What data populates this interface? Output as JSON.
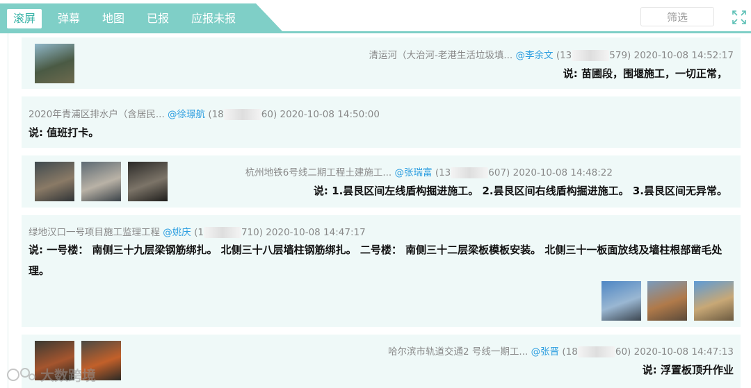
{
  "tabs": [
    "滚屏",
    "弹幕",
    "地图",
    "已报",
    "应报未报"
  ],
  "filter_label": "筛选",
  "said_prefix": "说: ",
  "posts": [
    {
      "title": "清运河（大治河-老港生活垃圾填...",
      "user": "@李余文",
      "phone_prefix": "(13",
      "phone_suffix": "579)",
      "time": "2020-10-08 14:52:17",
      "text": "苗圃段，围堰施工，一切正常，",
      "thumbs": [
        {
          "colors": [
            "#8fb7c9",
            "#4a5a44",
            "#6d6a4e"
          ]
        }
      ]
    },
    {
      "title": "2020年青浦区排水户（含居民...",
      "user": "@徐璟航",
      "phone_prefix": "(18",
      "phone_suffix": "60)",
      "time": "2020-10-08 14:50:00",
      "text": "值班打卡。",
      "thumbs": []
    },
    {
      "title": "杭州地铁6号线二期工程土建施工...",
      "user": "@张瑞富",
      "phone_prefix": "(13",
      "phone_suffix": "607)",
      "time": "2020-10-08 14:48:22",
      "text": "1.昙艮区间左线盾构掘进施工。 2.昙艮区间右线盾构掘进施工。 3.昙艮区间无异常。",
      "thumbs": [
        {
          "colors": [
            "#3f4a4f",
            "#8a7a66",
            "#2f3336"
          ]
        },
        {
          "colors": [
            "#5d6a73",
            "#b9b2a6",
            "#3a4248"
          ]
        },
        {
          "colors": [
            "#2b2a28",
            "#7c7468",
            "#1e1d1b"
          ]
        }
      ]
    },
    {
      "title": "绿地汉口一号项目施工监理工程",
      "user": "@姚庆",
      "phone_prefix": "(1",
      "phone_suffix": "710)",
      "time": "2020-10-08 14:47:17",
      "text": "一号楼： 南侧三十九层梁钢筋绑扎。 北侧三十八层墙柱钢筋绑扎。 二号楼： 南侧三十二层梁板模板安装。 北侧三十一板面放线及墙柱根部凿毛处理。",
      "thumbs": [
        {
          "colors": [
            "#4e86c4",
            "#9ab7d2",
            "#3c4650"
          ]
        },
        {
          "colors": [
            "#7a9bbd",
            "#b07a4a",
            "#5a4a3a"
          ]
        },
        {
          "colors": [
            "#5d9bd6",
            "#c8a876",
            "#6b5a40"
          ]
        }
      ]
    },
    {
      "title": "哈尔滨市轨道交通2 号线一期工...",
      "user": "@张晋",
      "phone_prefix": "(18",
      "phone_suffix": "60)",
      "time": "2020-10-08 14:47:13",
      "text": "浮置板顶升作业",
      "thumbs": [
        {
          "colors": [
            "#3b3a33",
            "#a5552e",
            "#252520"
          ]
        },
        {
          "colors": [
            "#4a4a44",
            "#c2602a",
            "#2a2a26"
          ]
        }
      ]
    }
  ],
  "watermark": "大数跨境",
  "colors": {
    "accent": "#7fcfc7",
    "tab_bg": "#7fcfc7",
    "card_bg": "#eff9f8",
    "user_link": "#2e9fe0"
  },
  "icons": [
    "expand-icon",
    "watermark-logo-icon"
  ]
}
